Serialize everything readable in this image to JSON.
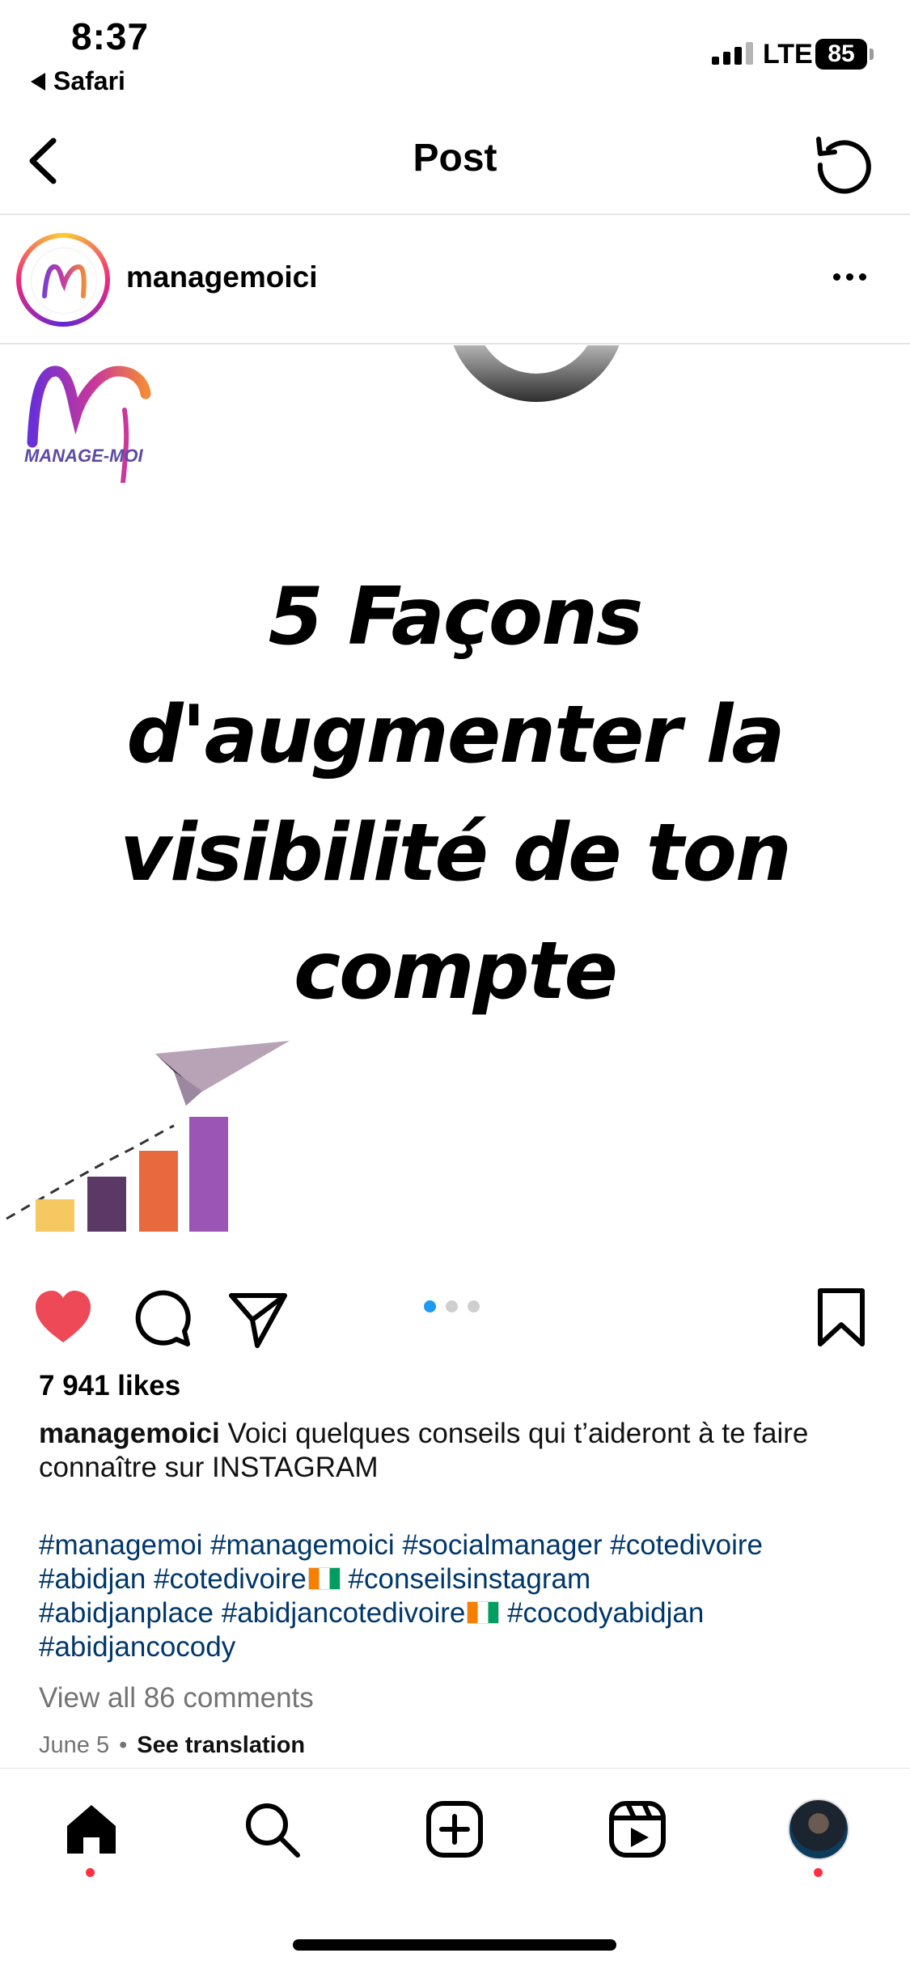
{
  "status_bar": {
    "time": "8:37",
    "back_app": "Safari",
    "network": "LTE",
    "battery": "85"
  },
  "nav": {
    "title": "Post",
    "back_icon": "chevron-left-icon",
    "refresh_icon": "refresh-icon"
  },
  "post": {
    "username": "managemoici",
    "more_icon": "more-horizontal-icon",
    "image": {
      "brand_text": "MANAGE-MOI",
      "headline_lines": [
        "5 Façons",
        "d'augmenter la",
        "visibilité de ton",
        "compte"
      ],
      "chart_bar_colors": [
        "#f5c862",
        "#5a3a64",
        "#e8693e",
        "#9b55b4"
      ]
    },
    "carousel": {
      "count": 3,
      "active_index": 0
    },
    "liked": true,
    "likes": "7 941 likes",
    "caption_user": "managemoici",
    "caption_text": "Voici quelques conseils qui t’aideront à te faire connaître sur INSTAGRAM",
    "hashtags": [
      "#managemoi",
      "#managemoici",
      "#socialmanager",
      "#cotedivoire",
      "#abidjan",
      "#cotedivoire",
      "#conseilsinstagram",
      "#abidjanplace",
      "#abidjancotedivoire",
      "#cocodyabidjan",
      "#abidjancocody"
    ],
    "view_comments": "View all 86 comments",
    "date": "June 5",
    "separator": "•",
    "see_translation": "See translation"
  },
  "tab_bar": {
    "items": [
      "home-icon",
      "search-icon",
      "create-icon",
      "reels-icon",
      "profile-avatar"
    ]
  },
  "colors": {
    "like": "#ed4956",
    "hashtag": "#00376b",
    "muted": "#737373",
    "active_dot": "#1d9bf0"
  }
}
